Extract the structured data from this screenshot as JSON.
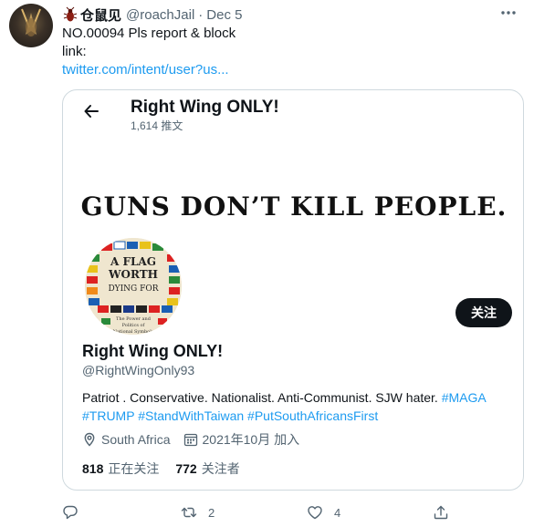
{
  "tweet": {
    "author_name": "仓鼠见",
    "author_handle": "@roachJail",
    "separator": "·",
    "date": "Dec 5",
    "line1": "NO.00094 Pls report & block",
    "line2": "link:",
    "link_text": "twitter.com/intent/user?us..."
  },
  "card": {
    "profile_title": "Right Wing ONLY!",
    "tweet_count": "1,614 推文",
    "banner_text": "GUNS DON’T KILL PEOPLE.",
    "avatar_book_lines": [
      "A FLAG",
      "WORTH",
      "DYING FOR",
      "The Power and",
      "Politics of",
      "National Symbols"
    ],
    "follow_button_label": "关注",
    "display_name": "Right Wing ONLY!",
    "handle": "@RightWingOnly93",
    "bio_text": "Patriot . Conservative. Nationalist. Anti-Communist. SJW hater. ",
    "bio_tags": [
      "#MAGA",
      "#TRUMP",
      "#StandWithTaiwan",
      "#PutSouthAfricansFirst"
    ],
    "location": "South Africa",
    "joined": "2021年10月 加入",
    "following_count": "818",
    "following_label": "正在关注",
    "followers_count": "772",
    "followers_label": "关注者"
  },
  "actions": {
    "retweet_count": "2",
    "like_count": "4"
  },
  "colors": {
    "link": "#1d9bf0",
    "secondary_text": "#536471",
    "primary_text": "#0f1419",
    "button_bg": "#0f1419"
  },
  "icons": [
    "bug-icon",
    "more-icon",
    "back-arrow-icon",
    "location-icon",
    "calendar-icon",
    "reply-icon",
    "retweet-icon",
    "like-icon",
    "share-icon"
  ]
}
